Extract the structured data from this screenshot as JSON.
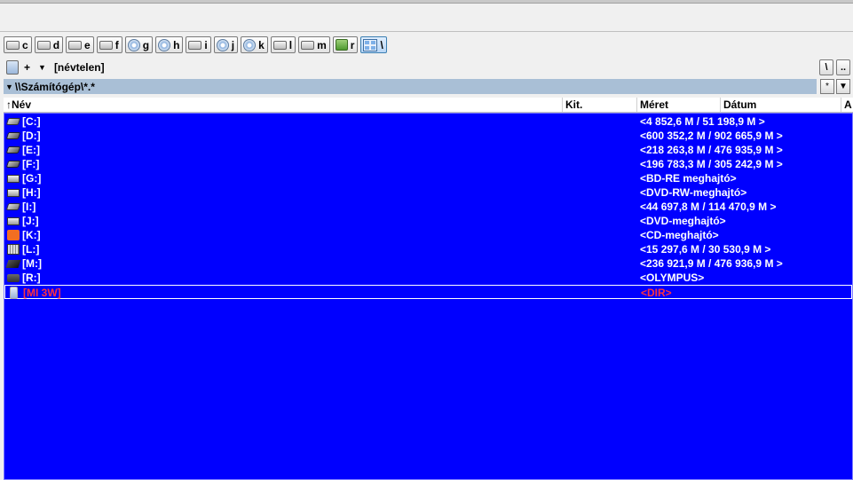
{
  "drivebar": {
    "drives": [
      {
        "letter": "c",
        "icon": "hard-disk-icon",
        "kind": "hdd"
      },
      {
        "letter": "d",
        "icon": "hard-disk-icon",
        "kind": "hdd"
      },
      {
        "letter": "e",
        "icon": "hard-disk-icon",
        "kind": "hdd"
      },
      {
        "letter": "f",
        "icon": "hard-disk-icon",
        "kind": "hdd"
      },
      {
        "letter": "g",
        "icon": "optical-disc-icon",
        "kind": "cd"
      },
      {
        "letter": "h",
        "icon": "optical-disc-icon",
        "kind": "cd"
      },
      {
        "letter": "i",
        "icon": "hard-disk-icon",
        "kind": "hdd"
      },
      {
        "letter": "j",
        "icon": "optical-disc-icon",
        "kind": "cd"
      },
      {
        "letter": "k",
        "icon": "optical-disc-icon",
        "kind": "cd"
      },
      {
        "letter": "l",
        "icon": "hard-disk-icon",
        "kind": "hdd"
      },
      {
        "letter": "m",
        "icon": "hard-disk-icon",
        "kind": "hdd"
      },
      {
        "letter": "r",
        "icon": "network-drive-icon",
        "kind": "net"
      },
      {
        "letter": "\\",
        "icon": "drive-tree-icon",
        "kind": "tree",
        "active": true
      }
    ]
  },
  "pathbar": {
    "plus": "+",
    "volume_name": "[névtelen]",
    "root_button": "\\",
    "up_button": ".."
  },
  "location": {
    "path": "\\\\Számítógép\\*.*",
    "history_button": "*",
    "dropdown_button": "▼"
  },
  "columns": {
    "name": "Név",
    "ext": "Kit.",
    "size": "Méret",
    "date": "Dátum",
    "attr": "A"
  },
  "rows": [
    {
      "name": "[C:]",
      "size": "<4 852,6 M / 51 198,9 M >",
      "icon": "hard-disk-icon",
      "cls": "ri-hdd"
    },
    {
      "name": "[D:]",
      "size": "<600 352,2 M / 902 665,9 M >",
      "icon": "hard-disk-icon",
      "cls": "ri-hdd2"
    },
    {
      "name": "[E:]",
      "size": "<218 263,8 M / 476 935,9 M >",
      "icon": "hard-disk-icon",
      "cls": "ri-hdd2"
    },
    {
      "name": "[F:]",
      "size": "<196 783,3 M / 305 242,9 M >",
      "icon": "hard-disk-icon",
      "cls": "ri-hdd2"
    },
    {
      "name": "[G:]",
      "size": "<BD-RE meghajtó>",
      "icon": "optical-drive-icon",
      "cls": "ri-opt"
    },
    {
      "name": "[H:]",
      "size": "<DVD-RW-meghajtó>",
      "icon": "optical-drive-icon",
      "cls": "ri-opt"
    },
    {
      "name": "[I:]",
      "size": "<44 697,8 M / 114 470,9 M >",
      "icon": "hard-disk-icon",
      "cls": "ri-hdd"
    },
    {
      "name": "[J:]",
      "size": "<DVD-meghajtó>",
      "icon": "optical-drive-icon",
      "cls": "ri-opt"
    },
    {
      "name": "[K:]",
      "size": "<CD-meghajtó>",
      "icon": "mi-drive-icon",
      "cls": "ri-mi"
    },
    {
      "name": "[L:]",
      "size": "<15 297,6 M / 30 530,9 M >",
      "icon": "memory-card-icon",
      "cls": "ri-card"
    },
    {
      "name": "[M:]",
      "size": "<236 921,9 M / 476 936,9 M >",
      "icon": "external-disk-icon",
      "cls": "ri-blk"
    },
    {
      "name": "[R:]",
      "size": "<OLYMPUS>",
      "icon": "camera-drive-icon",
      "cls": "ri-cam"
    },
    {
      "name": "[MI 3W]",
      "size": "<DIR>",
      "icon": "phone-device-icon",
      "cls": "ri-phone",
      "cursor": true
    }
  ]
}
